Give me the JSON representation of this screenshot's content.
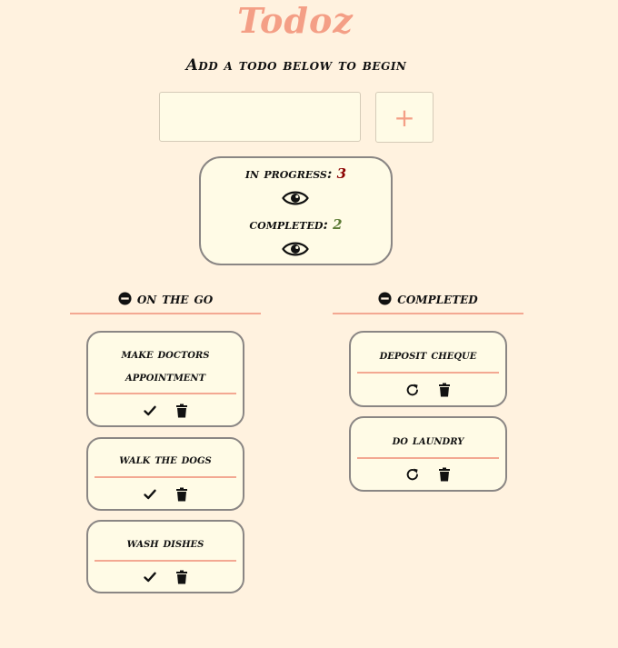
{
  "app": {
    "title": "Todoz",
    "subtitle": "Add a todo below to begin"
  },
  "input": {
    "value": "",
    "placeholder": ""
  },
  "add_button": {
    "label": "+"
  },
  "stats": {
    "in_progress_label": "in progress:",
    "in_progress_count": "3",
    "completed_label": "completed:",
    "completed_count": "2"
  },
  "sections": {
    "on_the_go": {
      "title": "on the go",
      "items": [
        "make doctors appointment",
        "walk the dogs",
        "wash dishes"
      ]
    },
    "completed": {
      "title": "completed",
      "items": [
        "deposit cheque",
        "do laundry"
      ]
    }
  },
  "icons": {
    "visibility": "eye-icon",
    "collapse": "minus-circle-icon",
    "complete": "check-icon",
    "delete": "trash-icon",
    "restore": "redo-icon"
  },
  "colors": {
    "background": "#fff2df",
    "accent": "#f49f86",
    "card": "#fffbe6",
    "in_progress": "#8b0000",
    "completed": "#5b7a34"
  }
}
